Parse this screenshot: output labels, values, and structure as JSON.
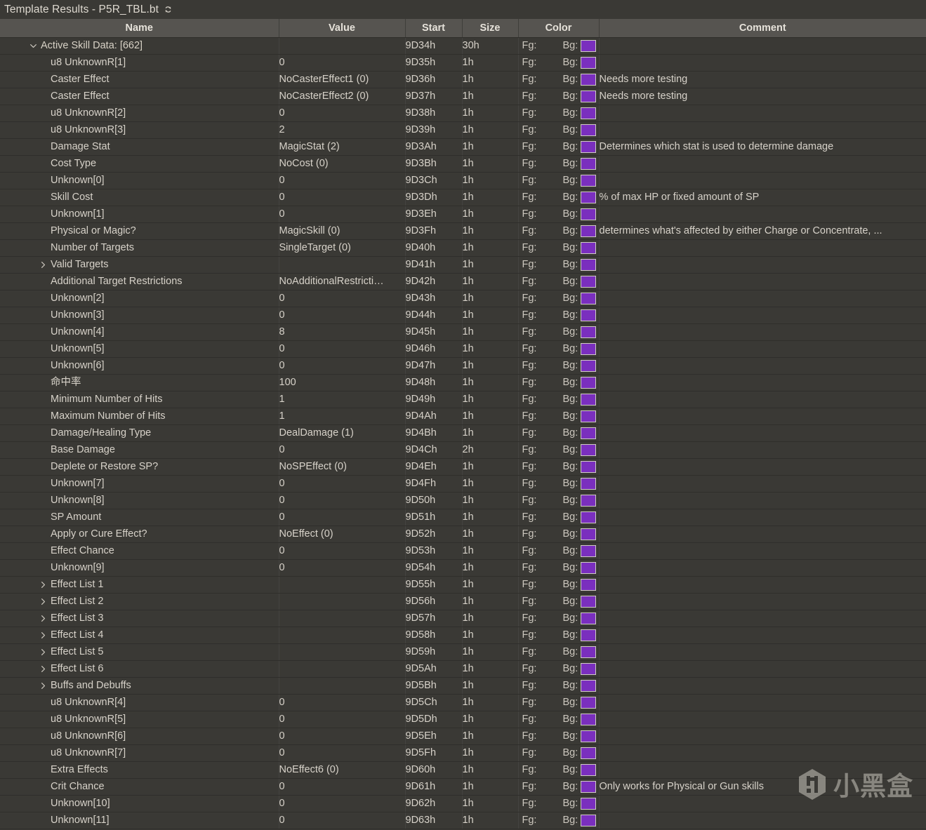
{
  "titlebar": {
    "title": "Template Results - P5R_TBL.bt",
    "refresh_icon": "refresh-icon"
  },
  "colors": {
    "window_bg": "#3a3935",
    "header_bg": "#565450",
    "row_bg": "#3a3935",
    "text": "#d7d2c9",
    "grid": "#2f2e2b",
    "swatch_purple": "#7a2fbe"
  },
  "table": {
    "columns": [
      {
        "key": "name",
        "label": "Name"
      },
      {
        "key": "value",
        "label": "Value"
      },
      {
        "key": "start",
        "label": "Start"
      },
      {
        "key": "size",
        "label": "Size"
      },
      {
        "key": "color",
        "label": "Color"
      },
      {
        "key": "comment",
        "label": "Comment"
      }
    ],
    "color_cell": {
      "fg_label": "Fg:",
      "bg_label": "Bg:",
      "bg_swatch": "#7a2fbe"
    },
    "rows": [
      {
        "indent": 0,
        "twisty": "expanded",
        "name": "Active Skill Data: [662]",
        "value": "",
        "start": "9D34h",
        "size": "30h",
        "comment": ""
      },
      {
        "indent": 1,
        "twisty": "none",
        "name": "u8 UnknownR[1]",
        "value": "0",
        "start": "9D35h",
        "size": "1h",
        "comment": ""
      },
      {
        "indent": 1,
        "twisty": "none",
        "name": "Caster Effect",
        "value": "NoCasterEffect1 (0)",
        "start": "9D36h",
        "size": "1h",
        "comment": "Needs more testing"
      },
      {
        "indent": 1,
        "twisty": "none",
        "name": "Caster Effect",
        "value": "NoCasterEffect2 (0)",
        "start": "9D37h",
        "size": "1h",
        "comment": "Needs more testing"
      },
      {
        "indent": 1,
        "twisty": "none",
        "name": "u8 UnknownR[2]",
        "value": "0",
        "start": "9D38h",
        "size": "1h",
        "comment": ""
      },
      {
        "indent": 1,
        "twisty": "none",
        "name": "u8 UnknownR[3]",
        "value": "2",
        "start": "9D39h",
        "size": "1h",
        "comment": ""
      },
      {
        "indent": 1,
        "twisty": "none",
        "name": "Damage Stat",
        "value": "MagicStat (2)",
        "start": "9D3Ah",
        "size": "1h",
        "comment": "Determines which stat is used to determine damage"
      },
      {
        "indent": 1,
        "twisty": "none",
        "name": "Cost Type",
        "value": "NoCost (0)",
        "start": "9D3Bh",
        "size": "1h",
        "comment": ""
      },
      {
        "indent": 1,
        "twisty": "none",
        "name": "Unknown[0]",
        "value": "0",
        "start": "9D3Ch",
        "size": "1h",
        "comment": ""
      },
      {
        "indent": 1,
        "twisty": "none",
        "name": "Skill Cost",
        "value": "0",
        "start": "9D3Dh",
        "size": "1h",
        "comment": "% of max HP or fixed amount of SP"
      },
      {
        "indent": 1,
        "twisty": "none",
        "name": "Unknown[1]",
        "value": "0",
        "start": "9D3Eh",
        "size": "1h",
        "comment": ""
      },
      {
        "indent": 1,
        "twisty": "none",
        "name": "Physical or Magic?",
        "value": "MagicSkill (0)",
        "start": "9D3Fh",
        "size": "1h",
        "comment": "determines what's affected by either Charge or Concentrate, ..."
      },
      {
        "indent": 1,
        "twisty": "none",
        "name": "Number of Targets",
        "value": "SingleTarget (0)",
        "start": "9D40h",
        "size": "1h",
        "comment": ""
      },
      {
        "indent": 1,
        "twisty": "collapsed",
        "name": "Valid Targets",
        "value": "",
        "start": "9D41h",
        "size": "1h",
        "comment": ""
      },
      {
        "indent": 1,
        "twisty": "none",
        "name": "Additional Target Restrictions",
        "value": "NoAdditionalRestricti…",
        "start": "9D42h",
        "size": "1h",
        "comment": ""
      },
      {
        "indent": 1,
        "twisty": "none",
        "name": "Unknown[2]",
        "value": "0",
        "start": "9D43h",
        "size": "1h",
        "comment": ""
      },
      {
        "indent": 1,
        "twisty": "none",
        "name": "Unknown[3]",
        "value": "0",
        "start": "9D44h",
        "size": "1h",
        "comment": ""
      },
      {
        "indent": 1,
        "twisty": "none",
        "name": "Unknown[4]",
        "value": "8",
        "start": "9D45h",
        "size": "1h",
        "comment": ""
      },
      {
        "indent": 1,
        "twisty": "none",
        "name": "Unknown[5]",
        "value": "0",
        "start": "9D46h",
        "size": "1h",
        "comment": ""
      },
      {
        "indent": 1,
        "twisty": "none",
        "name": "Unknown[6]",
        "value": "0",
        "start": "9D47h",
        "size": "1h",
        "comment": ""
      },
      {
        "indent": 1,
        "twisty": "none",
        "name": "命中率",
        "value": "100",
        "start": "9D48h",
        "size": "1h",
        "comment": ""
      },
      {
        "indent": 1,
        "twisty": "none",
        "name": "Minimum Number of Hits",
        "value": "1",
        "start": "9D49h",
        "size": "1h",
        "comment": ""
      },
      {
        "indent": 1,
        "twisty": "none",
        "name": "Maximum Number of Hits",
        "value": "1",
        "start": "9D4Ah",
        "size": "1h",
        "comment": ""
      },
      {
        "indent": 1,
        "twisty": "none",
        "name": "Damage/Healing Type",
        "value": "DealDamage (1)",
        "start": "9D4Bh",
        "size": "1h",
        "comment": ""
      },
      {
        "indent": 1,
        "twisty": "none",
        "name": "Base Damage",
        "value": "0",
        "start": "9D4Ch",
        "size": "2h",
        "comment": ""
      },
      {
        "indent": 1,
        "twisty": "none",
        "name": "Deplete or Restore SP?",
        "value": "NoSPEffect (0)",
        "start": "9D4Eh",
        "size": "1h",
        "comment": ""
      },
      {
        "indent": 1,
        "twisty": "none",
        "name": "Unknown[7]",
        "value": "0",
        "start": "9D4Fh",
        "size": "1h",
        "comment": ""
      },
      {
        "indent": 1,
        "twisty": "none",
        "name": "Unknown[8]",
        "value": "0",
        "start": "9D50h",
        "size": "1h",
        "comment": ""
      },
      {
        "indent": 1,
        "twisty": "none",
        "name": "SP Amount",
        "value": "0",
        "start": "9D51h",
        "size": "1h",
        "comment": ""
      },
      {
        "indent": 1,
        "twisty": "none",
        "name": "Apply or Cure Effect?",
        "value": "NoEffect (0)",
        "start": "9D52h",
        "size": "1h",
        "comment": ""
      },
      {
        "indent": 1,
        "twisty": "none",
        "name": "Effect Chance",
        "value": "0",
        "start": "9D53h",
        "size": "1h",
        "comment": ""
      },
      {
        "indent": 1,
        "twisty": "none",
        "name": "Unknown[9]",
        "value": "0",
        "start": "9D54h",
        "size": "1h",
        "comment": ""
      },
      {
        "indent": 1,
        "twisty": "collapsed",
        "name": "Effect List 1",
        "value": "",
        "start": "9D55h",
        "size": "1h",
        "comment": ""
      },
      {
        "indent": 1,
        "twisty": "collapsed",
        "name": "Effect List 2",
        "value": "",
        "start": "9D56h",
        "size": "1h",
        "comment": ""
      },
      {
        "indent": 1,
        "twisty": "collapsed",
        "name": "Effect List 3",
        "value": "",
        "start": "9D57h",
        "size": "1h",
        "comment": ""
      },
      {
        "indent": 1,
        "twisty": "collapsed",
        "name": "Effect List 4",
        "value": "",
        "start": "9D58h",
        "size": "1h",
        "comment": ""
      },
      {
        "indent": 1,
        "twisty": "collapsed",
        "name": "Effect List 5",
        "value": "",
        "start": "9D59h",
        "size": "1h",
        "comment": ""
      },
      {
        "indent": 1,
        "twisty": "collapsed",
        "name": "Effect List 6",
        "value": "",
        "start": "9D5Ah",
        "size": "1h",
        "comment": ""
      },
      {
        "indent": 1,
        "twisty": "collapsed",
        "name": "Buffs and Debuffs",
        "value": "",
        "start": "9D5Bh",
        "size": "1h",
        "comment": ""
      },
      {
        "indent": 1,
        "twisty": "none",
        "name": "u8 UnknownR[4]",
        "value": "0",
        "start": "9D5Ch",
        "size": "1h",
        "comment": ""
      },
      {
        "indent": 1,
        "twisty": "none",
        "name": "u8 UnknownR[5]",
        "value": "0",
        "start": "9D5Dh",
        "size": "1h",
        "comment": ""
      },
      {
        "indent": 1,
        "twisty": "none",
        "name": "u8 UnknownR[6]",
        "value": "0",
        "start": "9D5Eh",
        "size": "1h",
        "comment": ""
      },
      {
        "indent": 1,
        "twisty": "none",
        "name": "u8 UnknownR[7]",
        "value": "0",
        "start": "9D5Fh",
        "size": "1h",
        "comment": ""
      },
      {
        "indent": 1,
        "twisty": "none",
        "name": "Extra Effects",
        "value": "NoEffect6 (0)",
        "start": "9D60h",
        "size": "1h",
        "comment": ""
      },
      {
        "indent": 1,
        "twisty": "none",
        "name": "Crit Chance",
        "value": "0",
        "start": "9D61h",
        "size": "1h",
        "comment": "Only works for Physical or Gun skills"
      },
      {
        "indent": 1,
        "twisty": "none",
        "name": "Unknown[10]",
        "value": "0",
        "start": "9D62h",
        "size": "1h",
        "comment": ""
      },
      {
        "indent": 1,
        "twisty": "none",
        "name": "Unknown[11]",
        "value": "0",
        "start": "9D63h",
        "size": "1h",
        "comment": ""
      }
    ]
  },
  "watermark": {
    "text": "小黑盒",
    "logo_icon": "hexagon-h-logo-icon"
  }
}
